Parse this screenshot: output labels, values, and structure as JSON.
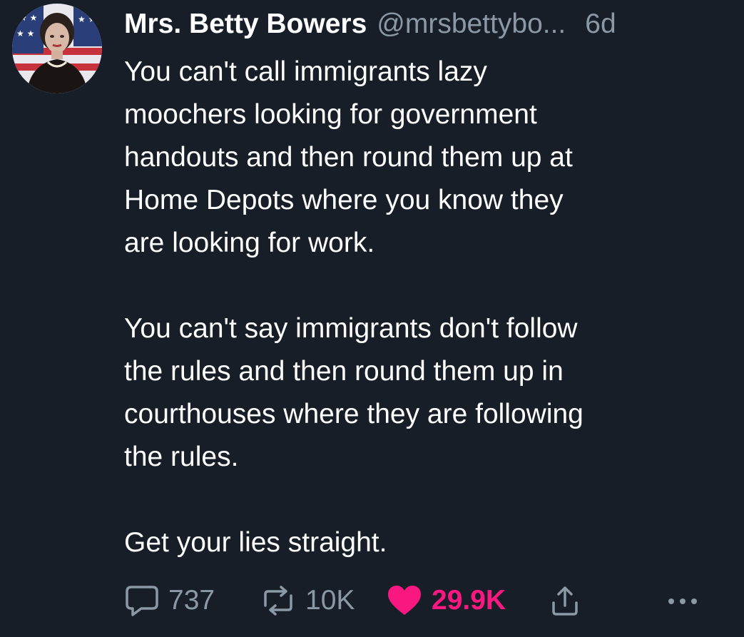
{
  "tweet": {
    "author": {
      "name": "Mrs. Betty Bowers",
      "handle": "@mrsbettybo...",
      "timestamp": "6d",
      "avatar_icon": "profile-avatar"
    },
    "paragraphs": [
      [
        "You can't call immigrants lazy",
        "moochers looking for government",
        "handouts and then round them up at",
        "Home Depots where you know they",
        "are looking for work."
      ],
      [
        "You can't say immigrants don't follow",
        "the rules and then round them up in",
        "courthouses where they are following",
        "the rules."
      ],
      [
        "Get your lies straight."
      ]
    ],
    "actions": {
      "reply": {
        "icon": "reply-icon",
        "count": "737"
      },
      "retweet": {
        "icon": "retweet-icon",
        "count": "10K"
      },
      "like": {
        "icon": "heart-icon",
        "count": "29.9K",
        "color": "#f91880"
      },
      "share": {
        "icon": "share-icon"
      },
      "more": {
        "icon": "more-icon"
      }
    }
  },
  "colors": {
    "background": "#171e27",
    "primary_text": "#ffffff",
    "secondary_text": "#8b98a5",
    "like": "#f91880"
  }
}
